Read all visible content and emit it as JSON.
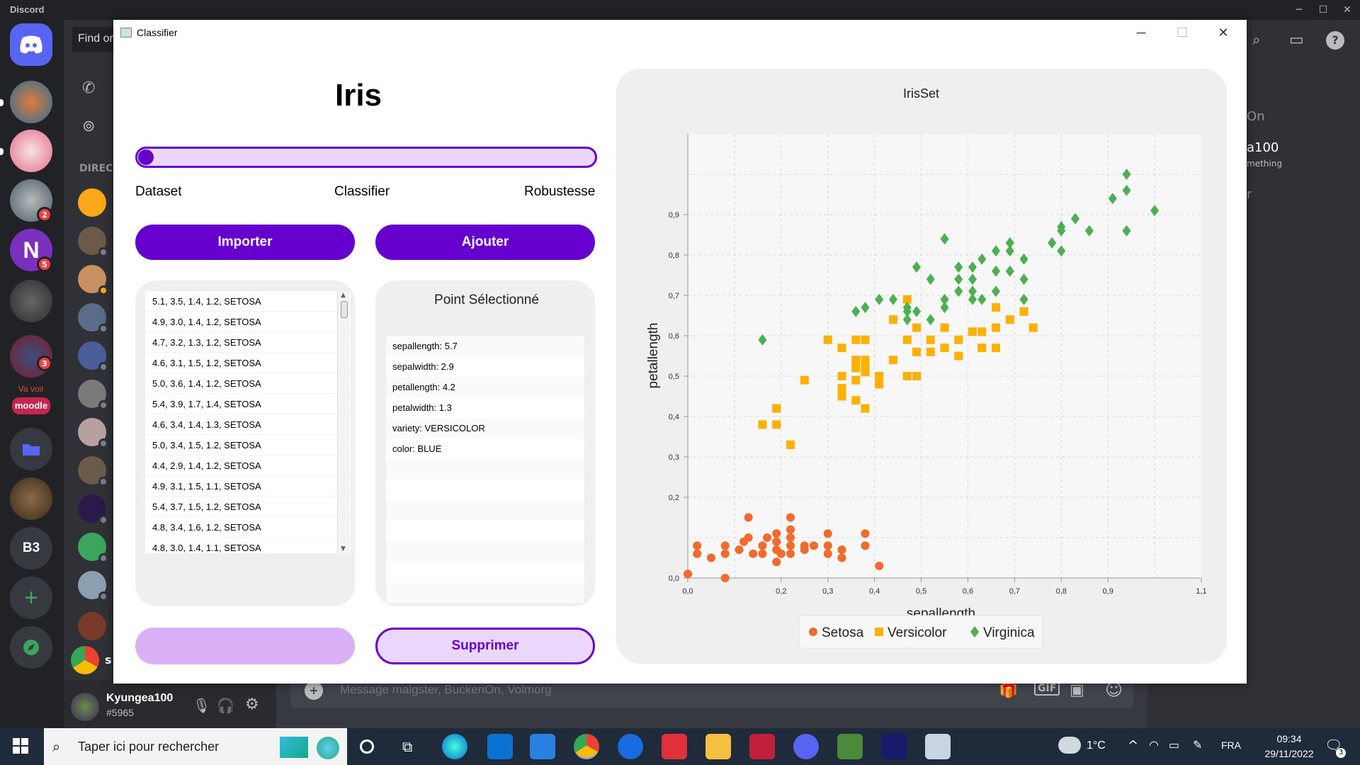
{
  "discord": {
    "app_title": "Discord",
    "search_placeholder": "Find or",
    "direct_label": "DIREC",
    "va_voir": "Va voir",
    "moodle": "moodle",
    "b3": "B3",
    "badges": [
      "2",
      "5",
      "3"
    ],
    "username": "Kyungea100",
    "user_tag": "#5965",
    "message_placeholder": "Message malgster, BuckeriOn, Volmorg",
    "right_panel": {
      "line1": "On",
      "user": "a100",
      "status": "mething",
      "letter": "r"
    },
    "sidebar_s": "s"
  },
  "window": {
    "title": "Classifier",
    "minimize": "─",
    "maximize": "☐",
    "close": "✕"
  },
  "app": {
    "title": "Iris",
    "progress_value": 0.0,
    "steps": [
      "Dataset",
      "Classifier",
      "Robustesse"
    ],
    "import_label": "Importer",
    "add_label": "Ajouter",
    "delete_label": "Supprimer",
    "selected_title": "Point Sélectionné"
  },
  "data_list": [
    "5.1, 3.5, 1.4, 1.2, SETOSA",
    "4.9, 3.0, 1.4, 1.2, SETOSA",
    "4.7, 3.2, 1.3, 1.2, SETOSA",
    "4.6, 3.1, 1.5, 1.2, SETOSA",
    "5.0, 3.6, 1.4, 1.2, SETOSA",
    "5.4, 3.9, 1.7, 1.4, SETOSA",
    "4.6, 3.4, 1.4, 1.3, SETOSA",
    "5.0, 3.4, 1.5, 1.2, SETOSA",
    "4.4, 2.9, 1.4, 1.2, SETOSA",
    "4.9, 3.1, 1.5, 1.1, SETOSA",
    "5.4, 3.7, 1.5, 1.2, SETOSA",
    "4.8, 3.4, 1.6, 1.2, SETOSA",
    "4.8, 3.0, 1.4, 1.1, SETOSA"
  ],
  "selected_point": [
    "sepallength: 5.7",
    "sepalwidth: 2.9",
    "petallength: 4.2",
    "petalwidth: 1.3",
    "variety: VERSICOLOR",
    "color: BLUE"
  ],
  "taskbar": {
    "search_placeholder": "Taper ici pour rechercher",
    "temperature": "1°C",
    "language": "FRA",
    "time": "09:34",
    "date": "29/11/2022",
    "notif": "3"
  },
  "colors": {
    "accent": "#6600cc",
    "setosa": "#f26b2c",
    "versicolor": "#ffb000",
    "virginica": "#4caf50"
  },
  "chart_data": {
    "type": "scatter",
    "title": "IrisSet",
    "xlabel": "sepallength",
    "ylabel": "petallength",
    "xlim": [
      0,
      1.1
    ],
    "ylim": [
      0,
      1.1
    ],
    "x_ticks": [
      "0,0",
      "0,2",
      "0,3",
      "0,4",
      "0,5",
      "0,6",
      "0,7",
      "0,8",
      "0,9",
      "1,1"
    ],
    "x_tick_values": [
      0,
      0.2,
      0.3,
      0.4,
      0.5,
      0.6,
      0.7,
      0.8,
      0.9,
      1.1
    ],
    "y_ticks": [
      "0,0",
      "0,2",
      "0,3",
      "0,4",
      "0,5",
      "0,6",
      "0,7",
      "0,8",
      "0,9"
    ],
    "y_tick_values": [
      0,
      0.2,
      0.3,
      0.4,
      0.5,
      0.6,
      0.7,
      0.8,
      0.9
    ],
    "legend_position": "bottom",
    "grid": true,
    "series": [
      {
        "name": "Setosa",
        "marker": "circle",
        "color": "#f26b2c",
        "points": [
          [
            0.0,
            0.01
          ],
          [
            0.02,
            0.06
          ],
          [
            0.02,
            0.08
          ],
          [
            0.05,
            0.05
          ],
          [
            0.08,
            0.06
          ],
          [
            0.08,
            0.08
          ],
          [
            0.08,
            0.0
          ],
          [
            0.11,
            0.07
          ],
          [
            0.12,
            0.09
          ],
          [
            0.13,
            0.1
          ],
          [
            0.13,
            0.15
          ],
          [
            0.14,
            0.06
          ],
          [
            0.16,
            0.06
          ],
          [
            0.16,
            0.08
          ],
          [
            0.17,
            0.1
          ],
          [
            0.19,
            0.04
          ],
          [
            0.19,
            0.07
          ],
          [
            0.19,
            0.09
          ],
          [
            0.19,
            0.11
          ],
          [
            0.2,
            0.06
          ],
          [
            0.22,
            0.06
          ],
          [
            0.22,
            0.08
          ],
          [
            0.22,
            0.1
          ],
          [
            0.22,
            0.12
          ],
          [
            0.22,
            0.15
          ],
          [
            0.25,
            0.07
          ],
          [
            0.25,
            0.08
          ],
          [
            0.27,
            0.08
          ],
          [
            0.3,
            0.06
          ],
          [
            0.3,
            0.08
          ],
          [
            0.3,
            0.11
          ],
          [
            0.33,
            0.05
          ],
          [
            0.33,
            0.07
          ],
          [
            0.38,
            0.08
          ],
          [
            0.38,
            0.11
          ],
          [
            0.41,
            0.03
          ]
        ]
      },
      {
        "name": "Versicolor",
        "marker": "square",
        "color": "#ffb000",
        "points": [
          [
            0.16,
            0.38
          ],
          [
            0.19,
            0.38
          ],
          [
            0.19,
            0.42
          ],
          [
            0.22,
            0.33
          ],
          [
            0.25,
            0.49
          ],
          [
            0.3,
            0.59
          ],
          [
            0.33,
            0.45
          ],
          [
            0.33,
            0.47
          ],
          [
            0.33,
            0.5
          ],
          [
            0.33,
            0.57
          ],
          [
            0.36,
            0.44
          ],
          [
            0.36,
            0.49
          ],
          [
            0.36,
            0.52
          ],
          [
            0.36,
            0.54
          ],
          [
            0.36,
            0.59
          ],
          [
            0.38,
            0.42
          ],
          [
            0.38,
            0.51
          ],
          [
            0.38,
            0.53
          ],
          [
            0.38,
            0.54
          ],
          [
            0.38,
            0.59
          ],
          [
            0.41,
            0.48
          ],
          [
            0.41,
            0.5
          ],
          [
            0.44,
            0.54
          ],
          [
            0.44,
            0.64
          ],
          [
            0.47,
            0.5
          ],
          [
            0.47,
            0.59
          ],
          [
            0.47,
            0.69
          ],
          [
            0.49,
            0.5
          ],
          [
            0.49,
            0.56
          ],
          [
            0.49,
            0.62
          ],
          [
            0.52,
            0.56
          ],
          [
            0.52,
            0.59
          ],
          [
            0.55,
            0.57
          ],
          [
            0.55,
            0.62
          ],
          [
            0.58,
            0.55
          ],
          [
            0.58,
            0.59
          ],
          [
            0.61,
            0.61
          ],
          [
            0.63,
            0.57
          ],
          [
            0.63,
            0.61
          ],
          [
            0.66,
            0.57
          ],
          [
            0.66,
            0.62
          ],
          [
            0.66,
            0.67
          ],
          [
            0.69,
            0.64
          ],
          [
            0.72,
            0.66
          ],
          [
            0.74,
            0.62
          ]
        ]
      },
      {
        "name": "Virginica",
        "marker": "diamond",
        "color": "#4caf50",
        "points": [
          [
            0.16,
            0.59
          ],
          [
            0.36,
            0.66
          ],
          [
            0.38,
            0.67
          ],
          [
            0.41,
            0.69
          ],
          [
            0.44,
            0.69
          ],
          [
            0.47,
            0.64
          ],
          [
            0.47,
            0.66
          ],
          [
            0.47,
            0.67
          ],
          [
            0.49,
            0.66
          ],
          [
            0.49,
            0.77
          ],
          [
            0.52,
            0.64
          ],
          [
            0.52,
            0.74
          ],
          [
            0.55,
            0.67
          ],
          [
            0.55,
            0.69
          ],
          [
            0.55,
            0.84
          ],
          [
            0.58,
            0.71
          ],
          [
            0.58,
            0.74
          ],
          [
            0.58,
            0.77
          ],
          [
            0.61,
            0.69
          ],
          [
            0.61,
            0.71
          ],
          [
            0.61,
            0.74
          ],
          [
            0.61,
            0.77
          ],
          [
            0.63,
            0.69
          ],
          [
            0.63,
            0.79
          ],
          [
            0.66,
            0.71
          ],
          [
            0.66,
            0.76
          ],
          [
            0.66,
            0.81
          ],
          [
            0.69,
            0.76
          ],
          [
            0.69,
            0.81
          ],
          [
            0.69,
            0.83
          ],
          [
            0.72,
            0.69
          ],
          [
            0.72,
            0.74
          ],
          [
            0.72,
            0.79
          ],
          [
            0.78,
            0.83
          ],
          [
            0.8,
            0.81
          ],
          [
            0.8,
            0.86
          ],
          [
            0.8,
            0.87
          ],
          [
            0.83,
            0.89
          ],
          [
            0.86,
            0.86
          ],
          [
            0.91,
            0.94
          ],
          [
            0.94,
            0.86
          ],
          [
            0.94,
            0.96
          ],
          [
            0.94,
            1.0
          ],
          [
            1.0,
            0.91
          ]
        ]
      }
    ]
  }
}
